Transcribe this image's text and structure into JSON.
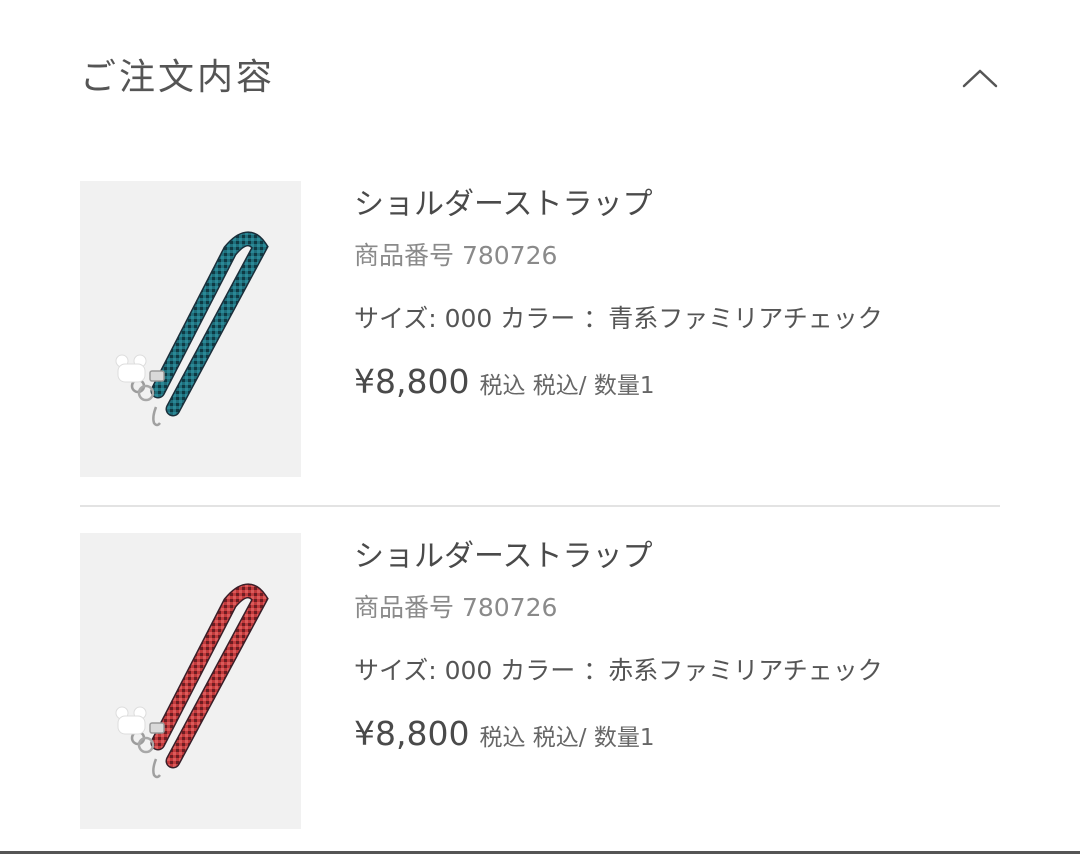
{
  "section": {
    "title": "ご注文内容",
    "toggle_icon": "chevron-up-icon"
  },
  "items": [
    {
      "name": "ショルダーストラップ",
      "product_number": "商品番号 780726",
      "variant": "サイズ: 000 カラー ：青系ファミリアチェック",
      "price": "¥8,800",
      "price_note": "税込 税込/ 数量1",
      "image_icon": "shoulder-strap-image",
      "strap_color": "#1e6b78"
    },
    {
      "name": "ショルダーストラップ",
      "product_number": "商品番号 780726",
      "variant": "サイズ: 000 カラー ：赤系ファミリアチェック",
      "price": "¥8,800",
      "price_note": "税込 税込/ 数量1",
      "image_icon": "shoulder-strap-image",
      "strap_color": "#c0393b"
    }
  ],
  "colors": {
    "background": "#ffffff",
    "thumb_background": "#f1f1f1",
    "divider": "#e3e3e3",
    "text_primary": "#4a4a4a",
    "text_secondary": "#8a8a8a"
  }
}
